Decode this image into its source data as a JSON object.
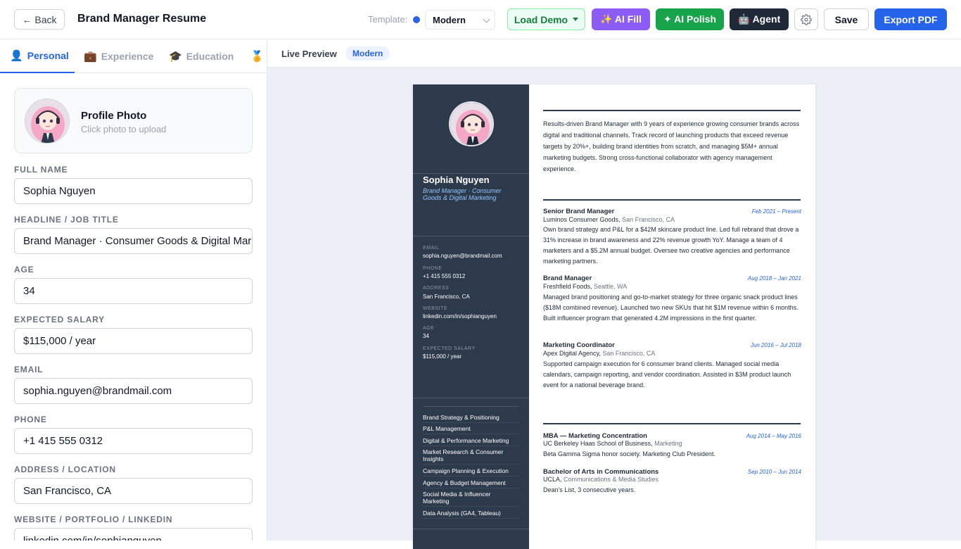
{
  "header": {
    "back_label": "← Back",
    "doc_title": "Brand Manager Resume",
    "template_label": "Template:",
    "template_value": "Modern",
    "load_demo_label": "Load Demo",
    "ai_fill_label": "✨ AI Fill",
    "ai_polish_label": "✦ AI Polish",
    "agent_label": "🤖 Agent",
    "save_label": "Save",
    "export_label": "Export PDF",
    "accent": "#2563eb"
  },
  "tabs": [
    {
      "icon": "👤",
      "label": "Personal",
      "active": true
    },
    {
      "icon": "💼",
      "label": "Experience",
      "active": false
    },
    {
      "icon": "🎓",
      "label": "Education",
      "active": false
    },
    {
      "icon": "🏅",
      "label": "",
      "active": false
    }
  ],
  "photo": {
    "title": "Profile Photo",
    "subtitle": "Click photo to upload"
  },
  "fields": [
    {
      "label": "FULL NAME",
      "value": "Sophia Nguyen"
    },
    {
      "label": "HEADLINE / JOB TITLE",
      "value": "Brand Manager · Consumer Goods & Digital Marketing"
    },
    {
      "label": "AGE",
      "value": "34"
    },
    {
      "label": "EXPECTED SALARY",
      "value": "$115,000 / year"
    },
    {
      "label": "EMAIL",
      "value": "sophia.nguyen@brandmail.com"
    },
    {
      "label": "PHONE",
      "value": "+1 415 555 0312"
    },
    {
      "label": "ADDRESS / LOCATION",
      "value": "San Francisco, CA"
    },
    {
      "label": "WEBSITE / PORTFOLIO / LINKEDIN",
      "value": "linkedin.com/in/sophianguyen"
    }
  ],
  "preview": {
    "title": "Live Preview",
    "badge": "Modern"
  },
  "resume": {
    "name": "Sophia Nguyen",
    "headline": "Brand Manager · Consumer Goods & Digital Marketing",
    "contact": [
      {
        "key": "EMAIL",
        "value": "sophia.nguyen@brandmail.com"
      },
      {
        "key": "PHONE",
        "value": "+1 415 555 0312"
      },
      {
        "key": "ADDRESS",
        "value": "San Francisco, CA"
      },
      {
        "key": "WEBSITE",
        "value": "linkedin.com/in/sophianguyen"
      },
      {
        "key": "AGE",
        "value": "34"
      },
      {
        "key": "EXPECTED SALARY",
        "value": "$115,000 / year"
      }
    ],
    "skills": [
      "Brand Strategy & Positioning",
      "P&L Management",
      "Digital & Performance Marketing",
      "Market Research & Consumer Insights",
      "Campaign Planning & Execution",
      "Agency & Budget Management",
      "Social Media & Influencer Marketing",
      "Data Analysis (GA4, Tableau)"
    ],
    "summary": "Results-driven Brand Manager with 9 years of experience growing consumer brands across digital and traditional channels. Track record of launching products that exceed revenue targets by 20%+, building brand identities from scratch, and managing $5M+ annual marketing budgets. Strong cross-functional collaborator with agency management experience.",
    "experience": [
      {
        "title": "Senior Brand Manager",
        "dates": "Feb 2021 – Present",
        "org": "Luminos Consumer Goods",
        "location": "San Francisco, CA",
        "desc": "Own brand strategy and P&L for a $42M skincare product line. Led full rebrand that drove a 31% increase in brand awareness and 22% revenue growth YoY. Manage a team of 4 marketers and a $5.2M annual budget. Oversee two creative agencies and performance marketing partners."
      },
      {
        "title": "Brand Manager",
        "dates": "Aug 2018 – Jan 2021",
        "org": "Freshfield Foods",
        "location": "Seattle, WA",
        "desc": "Managed brand positioning and go-to-market strategy for three organic snack product lines ($18M combined revenue). Launched two new SKUs that hit $1M revenue within 6 months. Built influencer program that generated 4.2M impressions in the first quarter."
      },
      {
        "title": "Marketing Coordinator",
        "dates": "Jun 2016 – Jul 2018",
        "org": "Apex Digital Agency",
        "location": "San Francisco, CA",
        "desc": "Supported campaign execution for 6 consumer brand clients. Managed social media calendars, campaign reporting, and vendor coordination. Assisted in $3M product launch event for a national beverage brand."
      }
    ],
    "education": [
      {
        "title": "MBA — Marketing Concentration",
        "dates": "Aug 2014 – May 2016",
        "org": "UC Berkeley Haas School of Business",
        "location": "Marketing",
        "desc": "Beta Gamma Sigma honor society. Marketing Club President."
      },
      {
        "title": "Bachelor of Arts in Communications",
        "dates": "Sep 2010 – Jun 2014",
        "org": "UCLA",
        "location": "Communications & Media Studies",
        "desc": "Dean's List, 3 consecutive years."
      }
    ]
  }
}
